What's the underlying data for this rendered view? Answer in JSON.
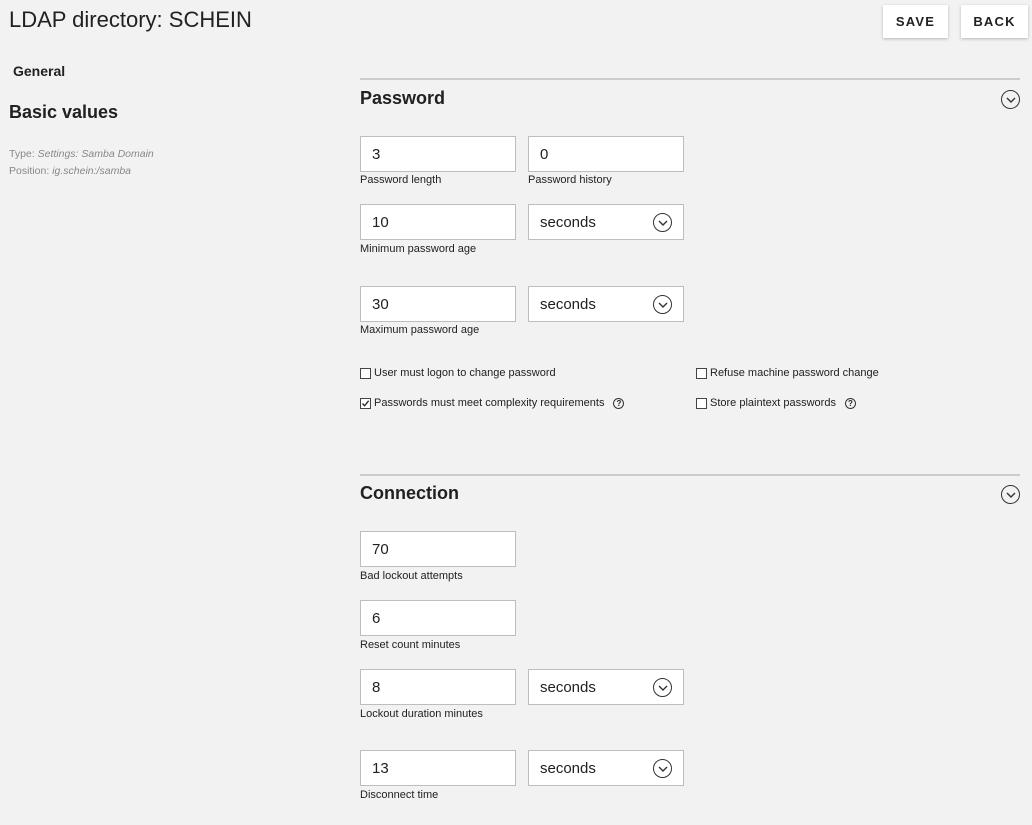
{
  "header": {
    "title": "LDAP directory: SCHEIN",
    "save_label": "SAVE",
    "back_label": "BACK"
  },
  "sidebar": {
    "tab_label": "General",
    "heading": "Basic values",
    "type_label": "Type:",
    "type_value": "Settings: Samba Domain",
    "position_label": "Position:",
    "position_value": "ig.schein:/samba"
  },
  "password_section": {
    "title": "Password",
    "password_length": {
      "value": "3",
      "label": "Password length"
    },
    "password_history": {
      "value": "0",
      "label": "Password history"
    },
    "min_password_age": {
      "value": "10",
      "unit": "seconds",
      "label": "Minimum password age"
    },
    "max_password_age": {
      "value": "30",
      "unit": "seconds",
      "label": "Maximum password age"
    },
    "checkboxes": {
      "logon_to_change": {
        "label": "User must logon to change password",
        "checked": false
      },
      "refuse_machine_change": {
        "label": "Refuse machine password change",
        "checked": false
      },
      "complexity": {
        "label": "Passwords must meet complexity requirements",
        "checked": true
      },
      "store_plaintext": {
        "label": "Store plaintext passwords",
        "checked": false
      }
    }
  },
  "connection_section": {
    "title": "Connection",
    "bad_lockout_attempts": {
      "value": "70",
      "label": "Bad lockout attempts"
    },
    "reset_count_minutes": {
      "value": "6",
      "label": "Reset count minutes"
    },
    "lockout_duration": {
      "value": "8",
      "unit": "seconds",
      "label": "Lockout duration minutes"
    },
    "disconnect_time": {
      "value": "13",
      "unit": "seconds",
      "label": "Disconnect time"
    }
  },
  "icons": {
    "collapse": "chevron-circle-up-icon",
    "dropdown": "chevron-circle-down-icon",
    "help": "question-circle-icon",
    "check": "checkmark-icon"
  }
}
